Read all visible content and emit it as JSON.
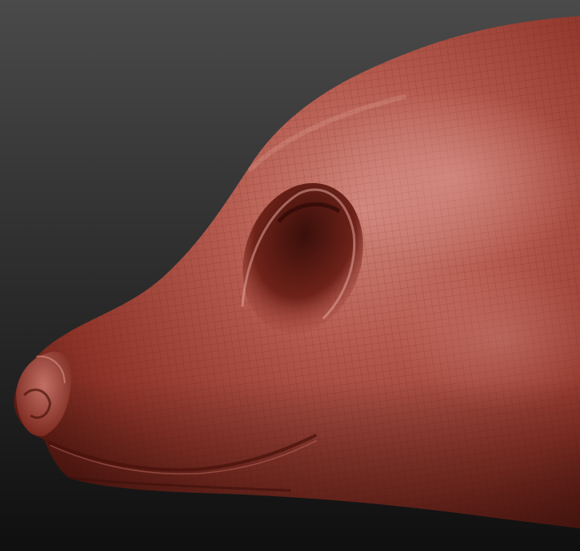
{
  "scene": {
    "subject": "sculpted-animal-head-mesh",
    "colors": {
      "background_top": "#4a4a4a",
      "background_bottom": "#0f0f0f",
      "clay_light": "#c97a70",
      "clay_mid": "#a8473c",
      "clay_dark": "#6e2219",
      "clay_shadow": "#3f120d",
      "wire": "#5a1a14"
    }
  }
}
